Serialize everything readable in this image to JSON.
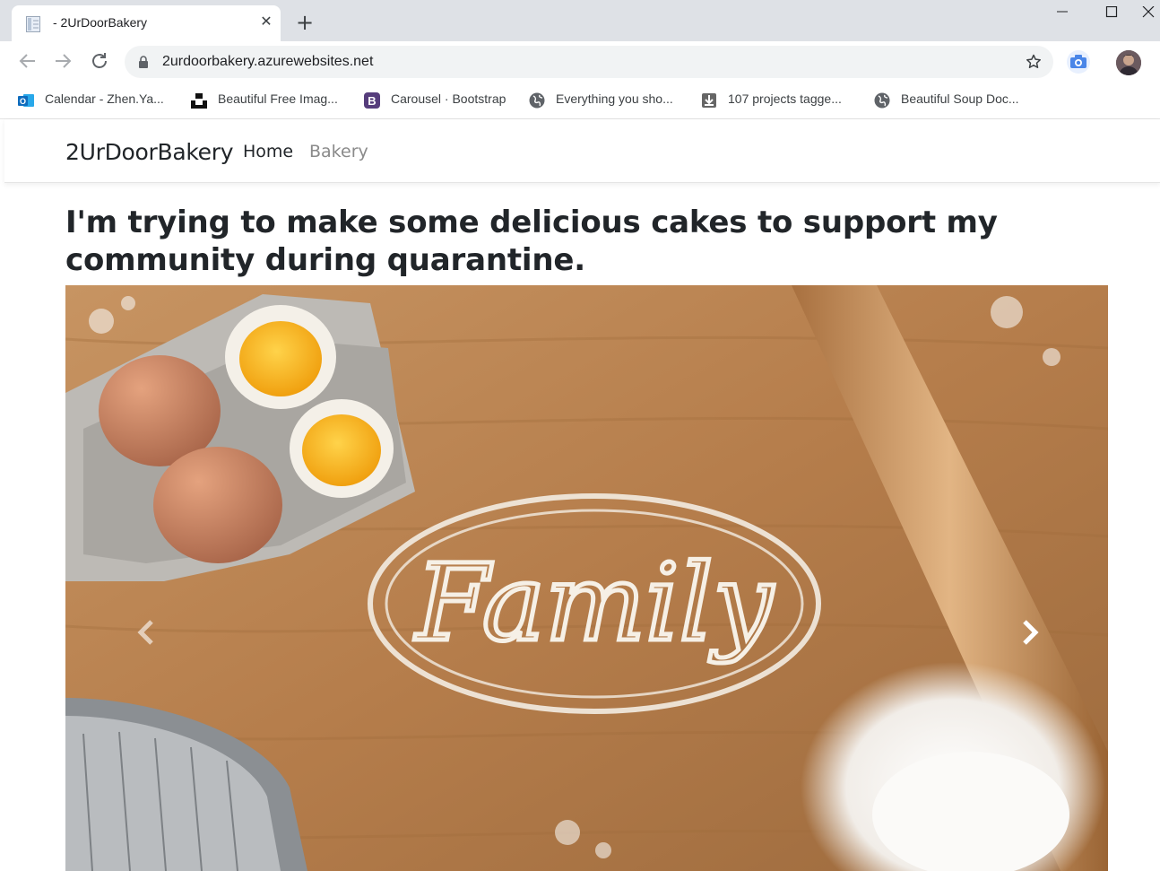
{
  "browser": {
    "tab": {
      "title": "- 2UrDoorBakery"
    },
    "omnibox": {
      "url": "2urdoorbakery.azurewebsites.net"
    },
    "bookmarks": [
      {
        "label": "Calendar - Zhen.Ya...",
        "icon": "outlook-icon"
      },
      {
        "label": "Beautiful Free Imag...",
        "icon": "unsplash-icon"
      },
      {
        "label": "Carousel · Bootstrap",
        "icon": "bootstrap-icon"
      },
      {
        "label": "Everything you sho...",
        "icon": "globe-icon"
      },
      {
        "label": "107 projects tagge...",
        "icon": "download-page-icon"
      },
      {
        "label": "Beautiful Soup Doc...",
        "icon": "globe-icon"
      }
    ]
  },
  "site": {
    "brand": "2UrDoorBakery",
    "nav": [
      {
        "label": "Home",
        "active": true
      },
      {
        "label": "Bakery",
        "active": false
      }
    ],
    "headline": "I'm trying to make some delicious cakes to support my community during quarantine.",
    "carousel": {
      "slide_text": "Family",
      "prev_icon": "chevron-left-icon",
      "next_icon": "chevron-right-icon"
    }
  },
  "colors": {
    "tabstrip": "#dee1e6",
    "omnibox": "#f1f3f4",
    "text": "#212529",
    "nav_muted": "#8a8a8a",
    "bootstrap_purple": "#563d7c",
    "outlook_blue": "#0f6cbd"
  }
}
